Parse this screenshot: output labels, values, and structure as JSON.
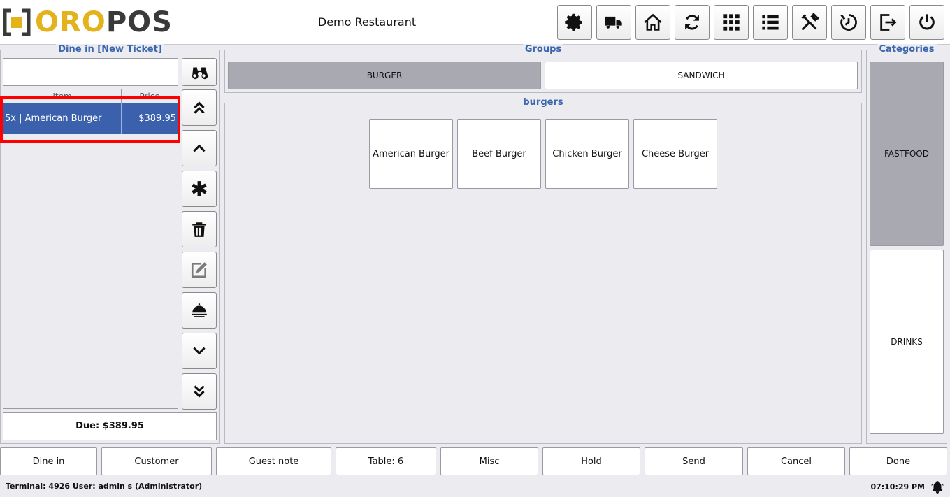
{
  "header": {
    "logo_text_a": "ORO",
    "logo_text_b": "POS",
    "restaurant_name": "Demo Restaurant",
    "toolbar_icons": [
      "gear-icon",
      "truck-icon",
      "home-icon",
      "refresh-icon",
      "grid-icon",
      "list-icon",
      "tools-icon",
      "clock-icon",
      "logout-icon",
      "power-icon"
    ]
  },
  "ticket": {
    "legend": "Dine in [New Ticket]",
    "search_value": "",
    "columns": {
      "item": "Item",
      "price": "Price"
    },
    "rows": [
      {
        "item": "5x | American Burger",
        "price": "$389.95"
      }
    ],
    "due": "Due: $389.95"
  },
  "groups": {
    "legend": "Groups",
    "items": [
      {
        "label": "BURGER",
        "active": true
      },
      {
        "label": "SANDWICH",
        "active": false
      }
    ]
  },
  "menu": {
    "legend": "burgers",
    "items": [
      "American Burger",
      "Beef Burger",
      "Chicken Burger",
      "Cheese Burger"
    ]
  },
  "categories": {
    "legend": "Categories",
    "items": [
      {
        "label": "FASTFOOD",
        "active": true
      },
      {
        "label": "DRINKS",
        "active": false
      }
    ]
  },
  "actions": [
    "Dine in",
    "Customer",
    "Guest note",
    "Table: 6",
    "Misc",
    "Hold",
    "Send",
    "Cancel",
    "Done"
  ],
  "status": {
    "left": "Terminal: 4926 User: admin s (Administrator)",
    "time": "07:10:29 PM"
  },
  "colors": {
    "accent": "#3b61ad",
    "brand_yellow": "#e4b21a",
    "legend_blue": "#3a66b0",
    "highlight": "#ff0000"
  }
}
